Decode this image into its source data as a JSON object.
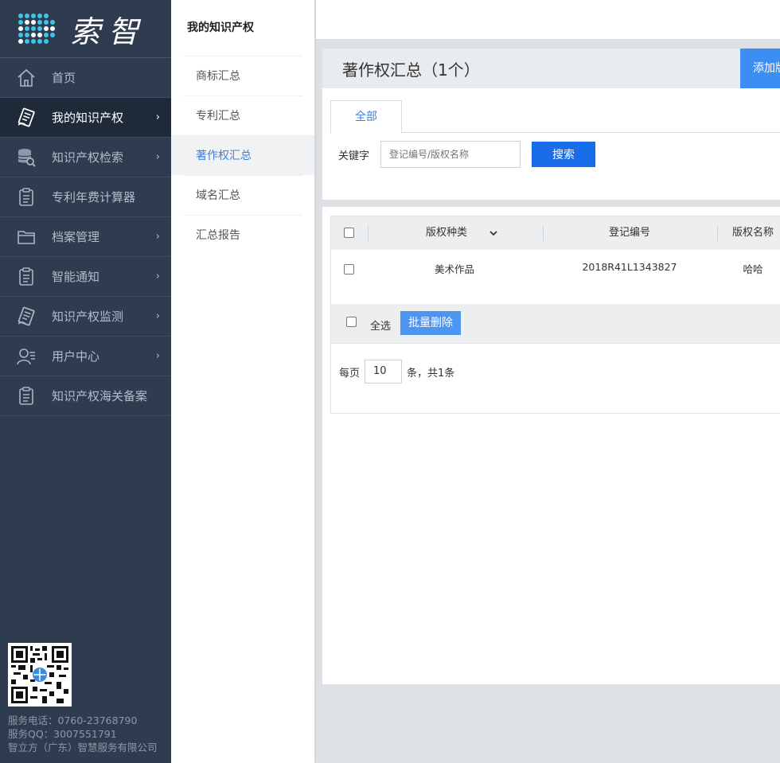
{
  "brand": {
    "name": "索智"
  },
  "sidebar": {
    "items": [
      {
        "label": "首页",
        "icon": "home-icon",
        "has_arrow": false
      },
      {
        "label": "我的知识产权",
        "icon": "document-icon",
        "has_arrow": true,
        "active": true
      },
      {
        "label": "知识产权检索",
        "icon": "database-search-icon",
        "has_arrow": true
      },
      {
        "label": "专利年费计算器",
        "icon": "clipboard-icon",
        "has_arrow": false
      },
      {
        "label": "档案管理",
        "icon": "folder-icon",
        "has_arrow": true
      },
      {
        "label": "智能通知",
        "icon": "clipboard-icon",
        "has_arrow": true
      },
      {
        "label": "知识产权监测",
        "icon": "document-icon",
        "has_arrow": true
      },
      {
        "label": "用户中心",
        "icon": "user-icon",
        "has_arrow": true
      },
      {
        "label": "知识产权海关备案",
        "icon": "clipboard-icon",
        "has_arrow": false
      }
    ],
    "chevron": "›",
    "footer": {
      "phone": "服务电话：0760-23768790",
      "qq": "服务QQ：3007551791",
      "company": "智立方（广东）智慧服务有限公司"
    }
  },
  "subnav": {
    "title": "我的知识产权",
    "items": [
      {
        "label": "商标汇总"
      },
      {
        "label": "专利汇总"
      },
      {
        "label": "著作权汇总",
        "active": true
      },
      {
        "label": "域名汇总"
      },
      {
        "label": "汇总报告"
      }
    ]
  },
  "main": {
    "heading": "著作权汇总（1个）",
    "add_button": "添加版权",
    "tab_all": "全部",
    "search": {
      "label": "关键字",
      "placeholder": "登记编号/版权名称",
      "button": "搜索"
    },
    "table": {
      "columns": [
        "版权种类",
        "登记编号",
        "版权名称"
      ],
      "rows": [
        {
          "type": "美术作品",
          "reg_no": "2018R41L1343827",
          "name": "哈哈"
        }
      ],
      "select_all": "全选",
      "bulk_delete": "批量删除"
    },
    "pager": {
      "per_page_label": "每页",
      "per_page_value": "10",
      "summary": "条，共1条"
    }
  },
  "colors": {
    "sidebar_bg": "#2f3b4e",
    "accent": "#1a6de8",
    "active_link": "#3f7fd9"
  }
}
